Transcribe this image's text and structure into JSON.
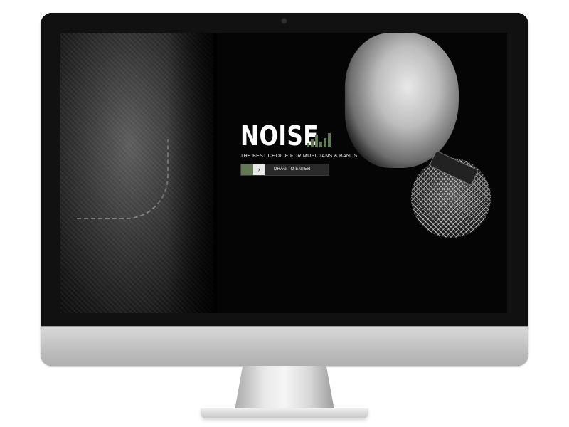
{
  "brand": {
    "name": "NOISE",
    "tagline": "THE BEST CHOICE FOR MUSICIANS & BANDS",
    "accent": "#617a55"
  },
  "enter_slider": {
    "label": "DRAG TO ENTER",
    "handle_icon": "chevron-right-icon",
    "progress": 0.14
  },
  "equalizer": {
    "icon": "equalizer-bars-icon",
    "levels": [
      0.25,
      0.45,
      0.7,
      0.35,
      0.55,
      0.85
    ]
  },
  "device": {
    "type": "desktop-monitor-mockup",
    "camera_icon": "webcam-icon"
  }
}
